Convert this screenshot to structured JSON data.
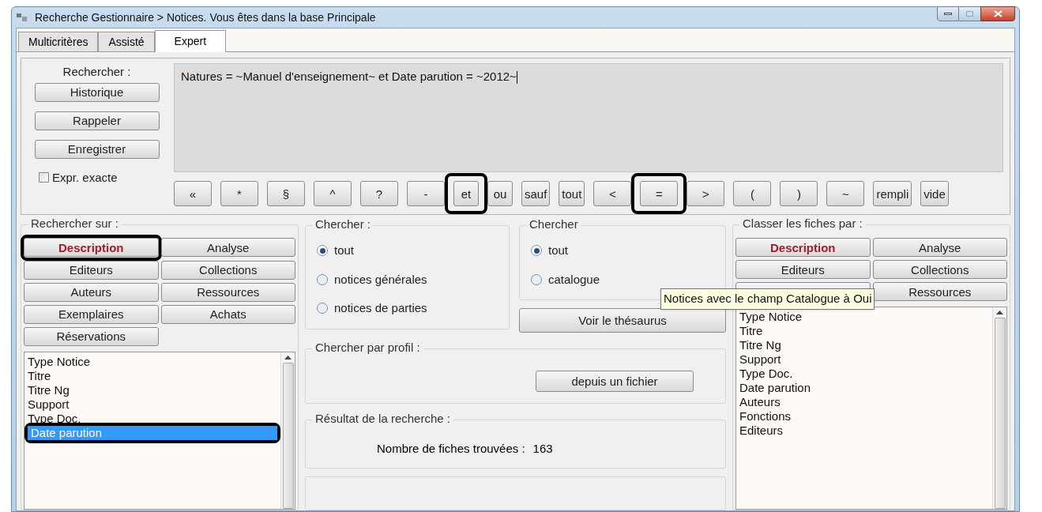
{
  "window": {
    "title": "Recherche Gestionnaire > Notices.  Vous êtes dans la base Principale"
  },
  "tabs": [
    {
      "label": "Multicritères",
      "selected": false
    },
    {
      "label": "Assisté",
      "selected": false
    },
    {
      "label": "Expert",
      "selected": true
    }
  ],
  "query": {
    "label": "Rechercher :",
    "value": "Natures = ~Manuel d'enseignement~ et Date parution = ~2012~",
    "side_buttons": [
      "Historique",
      "Rappeler",
      "Enregistrer"
    ],
    "exact": {
      "label": "Expr. exacte",
      "checked": false
    }
  },
  "operators": [
    {
      "label": "«",
      "highlighted": false
    },
    {
      "label": "*",
      "highlighted": false
    },
    {
      "label": "§",
      "highlighted": false
    },
    {
      "label": "^",
      "highlighted": false
    },
    {
      "label": "?",
      "highlighted": false
    },
    {
      "label": "-",
      "highlighted": false
    },
    {
      "label": "et",
      "highlighted": true
    },
    {
      "label": "ou",
      "highlighted": false
    },
    {
      "label": "sauf",
      "highlighted": false
    },
    {
      "label": "tout",
      "highlighted": false
    },
    {
      "label": "<",
      "highlighted": false
    },
    {
      "label": "=",
      "highlighted": true
    },
    {
      "label": ">",
      "highlighted": false
    },
    {
      "label": "(",
      "highlighted": false
    },
    {
      "label": ")",
      "highlighted": false
    },
    {
      "label": "~",
      "highlighted": false
    },
    {
      "label": "rempli",
      "highlighted": false
    },
    {
      "label": "vide",
      "highlighted": false
    }
  ],
  "search_on": {
    "title": "Rechercher sur :",
    "buttons": [
      {
        "kind": "button",
        "label": "Description",
        "selected": true,
        "highlighted": true
      },
      {
        "kind": "button",
        "label": "Analyse",
        "selected": false,
        "highlighted": false
      },
      {
        "kind": "button",
        "label": "Editeurs",
        "selected": false,
        "highlighted": false
      },
      {
        "kind": "button",
        "label": "Collections",
        "selected": false,
        "highlighted": false
      },
      {
        "kind": "button",
        "label": "Auteurs",
        "selected": false,
        "highlighted": false
      },
      {
        "kind": "button",
        "label": "Ressources",
        "selected": false,
        "highlighted": false
      },
      {
        "kind": "button",
        "label": "Exemplaires",
        "selected": false,
        "highlighted": false
      },
      {
        "kind": "button",
        "label": "Achats",
        "selected": false,
        "highlighted": false
      },
      {
        "kind": "button",
        "label": "Réservations",
        "selected": false,
        "highlighted": false
      }
    ],
    "fields": [
      {
        "label": "Type Notice",
        "selected": false,
        "highlighted": false
      },
      {
        "label": "Titre",
        "selected": false,
        "highlighted": false
      },
      {
        "label": "Titre Ng",
        "selected": false,
        "highlighted": false
      },
      {
        "label": "Support",
        "selected": false,
        "highlighted": false
      },
      {
        "label": "Type Doc.",
        "selected": false,
        "highlighted": false
      },
      {
        "label": "Date parution",
        "selected": true,
        "highlighted": true
      }
    ]
  },
  "search_scope": {
    "title": "Chercher :",
    "options": [
      {
        "label": "tout",
        "selected": true
      },
      {
        "label": "notices générales",
        "selected": false
      },
      {
        "label": "notices de parties",
        "selected": false
      }
    ]
  },
  "catalog_scope": {
    "title": "Chercher",
    "options": [
      {
        "label": "tout",
        "selected": true
      },
      {
        "label": "catalogue",
        "selected": false
      }
    ],
    "button": "Voir le thésaurus"
  },
  "profile": {
    "title": "Chercher par profil :",
    "button": "depuis un fichier"
  },
  "result": {
    "title": "Résultat de la recherche :",
    "label": "Nombre de fiches trouvées :",
    "count": "163"
  },
  "sort_by": {
    "title": "Classer les fiches par :",
    "buttons": [
      {
        "kind": "button",
        "label": "Description",
        "selected": true
      },
      {
        "kind": "button",
        "label": "Analyse",
        "selected": false
      },
      {
        "kind": "button",
        "label": "Editeurs",
        "selected": false
      },
      {
        "kind": "button",
        "label": "Collections",
        "selected": false
      },
      {
        "kind": "covered"
      },
      {
        "kind": "button",
        "label": "Ressources",
        "selected": false
      }
    ],
    "fields": [
      {
        "label": "Type Notice",
        "selected": false
      },
      {
        "label": "Titre",
        "selected": false
      },
      {
        "label": "Titre Ng",
        "selected": false
      },
      {
        "label": "Support",
        "selected": false
      },
      {
        "label": "Type Doc.",
        "selected": false
      },
      {
        "label": "Date parution",
        "selected": false
      },
      {
        "label": "Auteurs",
        "selected": false
      },
      {
        "label": "Fonctions",
        "selected": false
      },
      {
        "label": "Editeurs",
        "selected": false
      }
    ]
  },
  "tooltip": "Notices avec le champ Catalogue à Oui"
}
